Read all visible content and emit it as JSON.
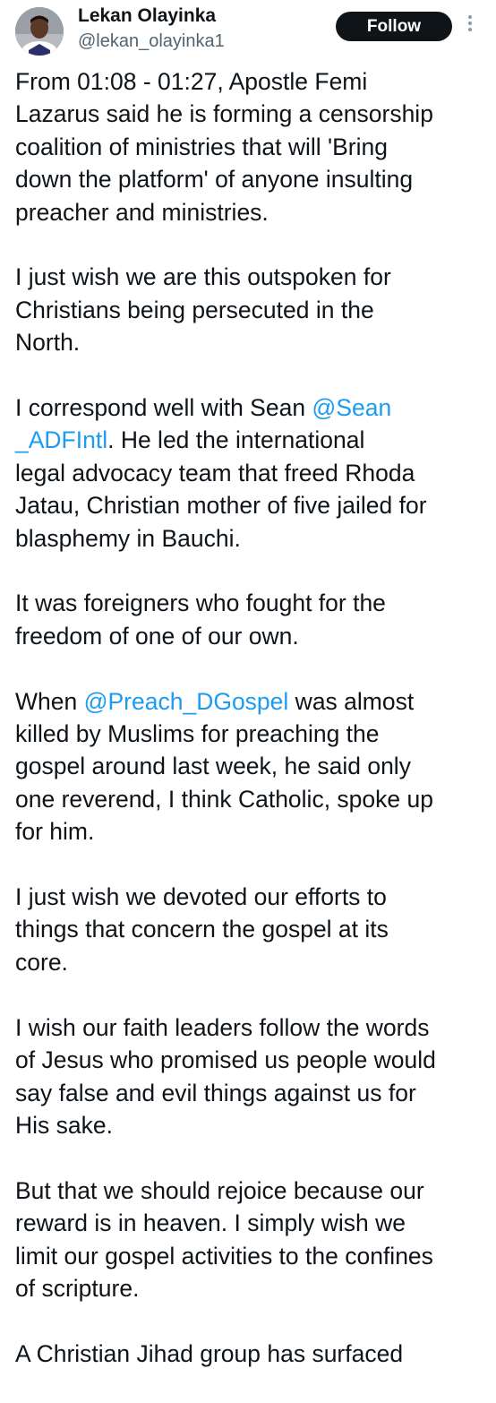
{
  "header": {
    "display_name": "Lekan Olayinka",
    "handle": "@lekan_olayinka1",
    "follow_label": "Follow",
    "avatar_icon": "profile-photo-icon",
    "more_icon": "more-options-icon"
  },
  "colors": {
    "text": "#0f1419",
    "secondary_text": "#536471",
    "mention": "#1d9bf0",
    "follow_button_bg": "#0f1419",
    "follow_button_text": "#ffffff"
  },
  "tweet": {
    "p1": {
      "l1": "From 01:08 - 01:27, Apostle Femi",
      "l2": "Lazarus said he is forming a censorship",
      "l3": "coalition of ministries that will 'Bring",
      "l4": "down the platform' of anyone insulting",
      "l5": "preacher and ministries."
    },
    "p2": {
      "l1": "I just wish we are this outspoken for",
      "l2": "Christians being persecuted in the",
      "l3": "North."
    },
    "p3": {
      "l1_text": "I correspond well with Sean ",
      "l1_mention": "@Sean",
      "l2_mention": "_ADFIntl",
      "l2_text": ". He led the international",
      "l3": "legal advocacy team that freed Rhoda",
      "l4": "Jatau, Christian mother of five jailed for",
      "l5": "blasphemy in Bauchi."
    },
    "p4": {
      "l1": "It was foreigners who fought for the",
      "l2": "freedom of one of our own."
    },
    "p5": {
      "l1_text": "When ",
      "l1_mention": "@Preach_DGospel",
      "l1_after": " was almost",
      "l2": "killed by Muslims for preaching the",
      "l3": "gospel around last week, he said only",
      "l4": "one reverend, I think Catholic, spoke up",
      "l5": "for him."
    },
    "p6": {
      "l1": "I just wish we devoted our efforts to",
      "l2": "things that concern the gospel at its",
      "l3": "core."
    },
    "p7": {
      "l1": "I wish our faith leaders follow the words",
      "l2": "of Jesus who promised us people would",
      "l3": "say false and evil things against us for",
      "l4": "His sake."
    },
    "p8": {
      "l1": "But that we should rejoice because our",
      "l2": "reward is in heaven. I simply wish we",
      "l3": "limit our gospel activities to the confines",
      "l4": "of scripture."
    },
    "p9": {
      "l1": "A Christian Jihad group has surfaced"
    }
  }
}
